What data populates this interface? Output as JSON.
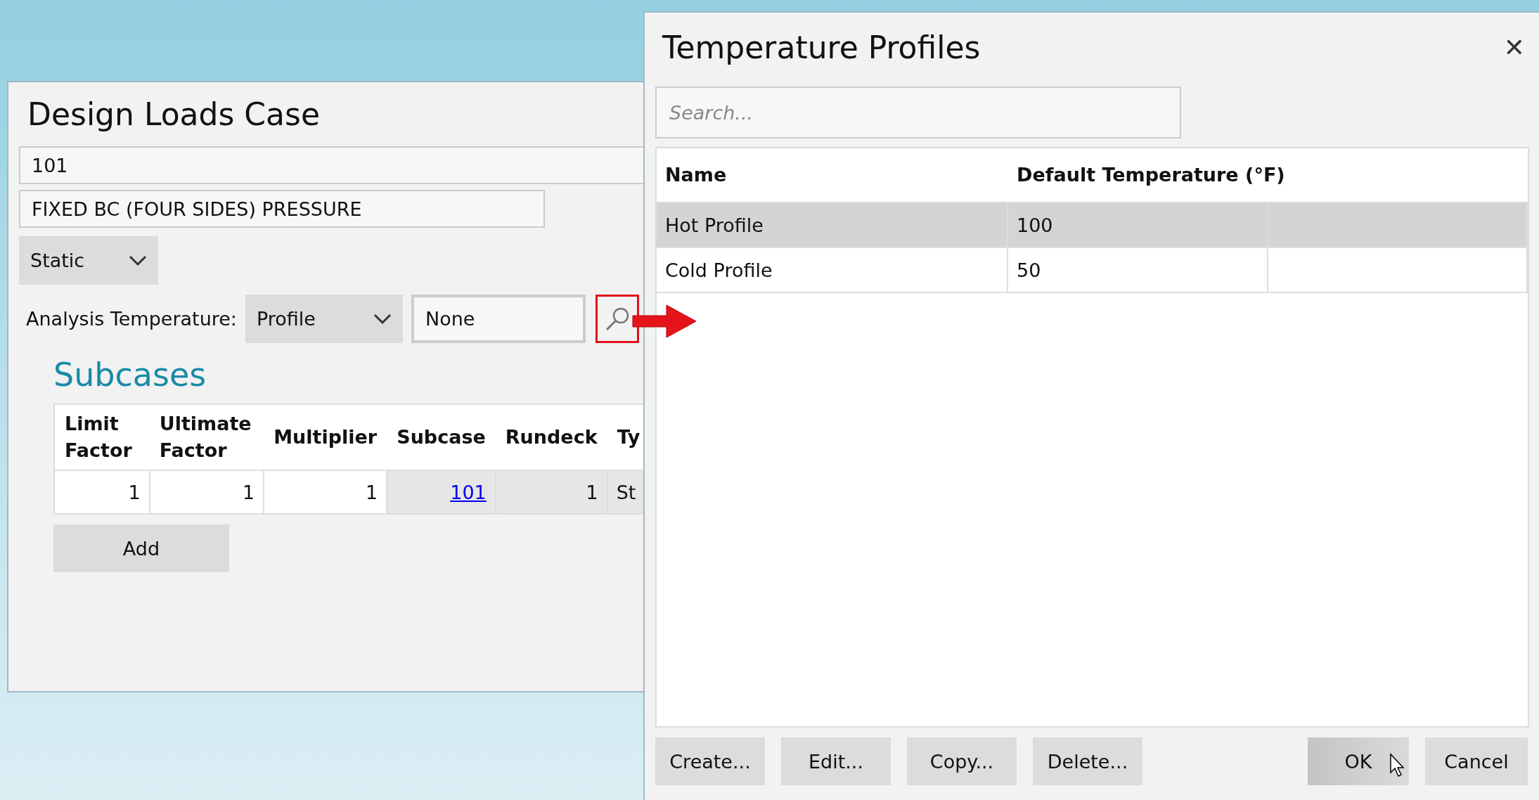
{
  "design_window": {
    "title": "Design Loads Case",
    "id_field": "101",
    "description_field": "FIXED BC (FOUR SIDES) PRESSURE",
    "type_dropdown": "Static",
    "analysis_temperature": {
      "label": "Analysis Temperature:",
      "mode_dropdown": "Profile",
      "profile_field": "None"
    },
    "subcases": {
      "heading": "Subcases",
      "columns": [
        {
          "label": "Limit Factor",
          "editable": true
        },
        {
          "label": "Ultimate Factor",
          "editable": true
        },
        {
          "label": "Multiplier",
          "editable": true
        },
        {
          "label": "Subcase",
          "editable": false
        },
        {
          "label": "Rundeck",
          "editable": false
        },
        {
          "label": "Ty",
          "editable": false
        }
      ],
      "rows": [
        {
          "cells": [
            {
              "text": "1",
              "kind": "number"
            },
            {
              "text": "1",
              "kind": "number"
            },
            {
              "text": "1",
              "kind": "number"
            },
            {
              "text": "101",
              "kind": "link"
            },
            {
              "text": "1",
              "kind": "number"
            },
            {
              "text": "St",
              "kind": "text"
            }
          ]
        }
      ],
      "add_button": "Add"
    }
  },
  "profiles_dialog": {
    "title": "Temperature Profiles",
    "close": "✕",
    "search": {
      "placeholder": "Search..."
    },
    "columns": [
      "Name",
      "Default Temperature (°F)"
    ],
    "rows": [
      {
        "name": "Hot Profile",
        "temperature": "100",
        "selected": true
      },
      {
        "name": "Cold Profile",
        "temperature": "50",
        "selected": false
      }
    ],
    "left_buttons": [
      "Create...",
      "Edit...",
      "Copy...",
      "Delete..."
    ],
    "right_buttons": [
      {
        "label": "OK",
        "hovered": true
      },
      {
        "label": "Cancel",
        "hovered": false
      }
    ]
  }
}
